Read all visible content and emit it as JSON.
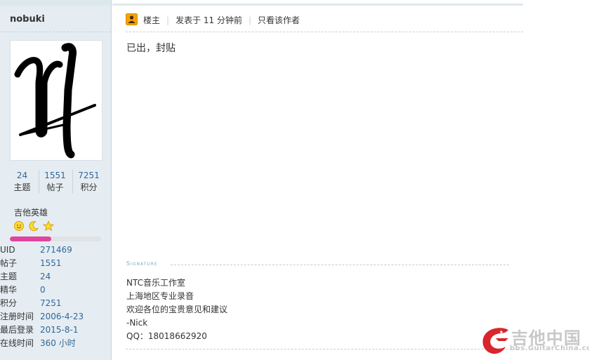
{
  "user": {
    "username": "nobuki",
    "stats": [
      {
        "value": "24",
        "label": "主题"
      },
      {
        "value": "1551",
        "label": "帖子"
      },
      {
        "value": "7251",
        "label": "积分"
      }
    ],
    "group": "吉他英雄",
    "rank_icons": [
      "sun-icon",
      "moon-icon",
      "star-icon"
    ],
    "progress_fraction": 0.45,
    "progress_color": "#e0449e",
    "info": [
      {
        "key": "UID",
        "value": "271469"
      },
      {
        "key": "帖子",
        "value": "1551"
      },
      {
        "key": "主题",
        "value": "24"
      },
      {
        "key": "精华",
        "value": "0"
      },
      {
        "key": "积分",
        "value": "7251"
      },
      {
        "key": "注册时间",
        "value": "2006-4-23"
      },
      {
        "key": "最后登录",
        "value": "2015-8-1"
      },
      {
        "key": "在线时间",
        "value": "360 小时"
      }
    ]
  },
  "post": {
    "author_role": "楼主",
    "posted": "发表于 11 分钟前",
    "only_author": "只看该作者",
    "body": "已出，封贴",
    "signature_label": "Signature",
    "signature": [
      "NTC音乐工作室",
      "上海地区专业录音",
      "欢迎各位的宝贵意见和建议",
      "-Nick",
      "QQ：18018662920"
    ]
  },
  "watermark": {
    "brand": "吉他中国",
    "url": "bbs.GuitarChina.com"
  }
}
